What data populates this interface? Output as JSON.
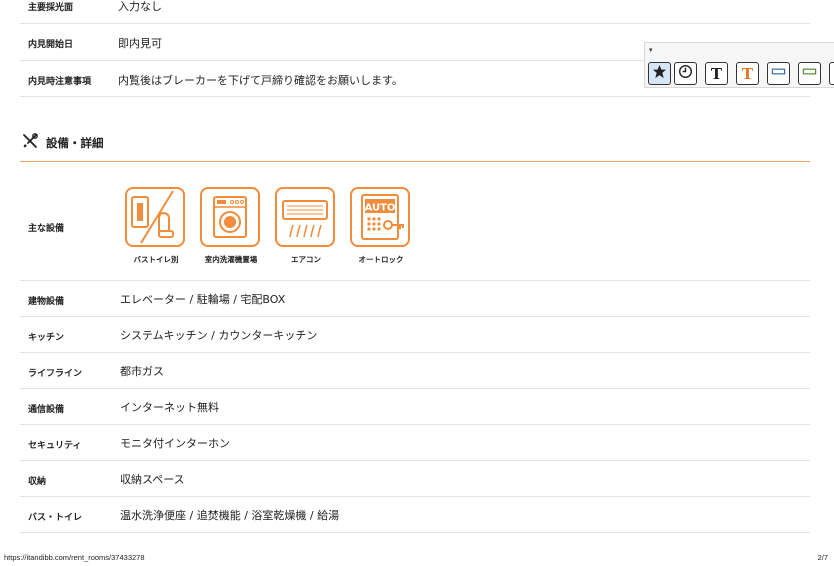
{
  "top_rows": [
    {
      "label": "主要採光面",
      "value": "入力なし"
    },
    {
      "label": "内見開始日",
      "value": "即内見可"
    },
    {
      "label": "内見時注意事項",
      "value": "内覧後はブレーカーを下げて戸締り確認をお願いします。"
    }
  ],
  "section": {
    "title": "設備・詳細",
    "icon": "tools-icon"
  },
  "features": {
    "label": "主な設備",
    "items": [
      {
        "caption": "バストイレ別",
        "icon": "bath-toilet-separate-icon"
      },
      {
        "caption": "室内洗濯機置場",
        "icon": "washing-machine-icon"
      },
      {
        "caption": "エアコン",
        "icon": "air-conditioner-icon"
      },
      {
        "caption": "オートロック",
        "icon": "auto-lock-icon",
        "icon_text": "AUTO"
      }
    ]
  },
  "detail_rows": [
    {
      "label": "建物設備",
      "value": "エレベーター / 駐輪場 / 宅配BOX"
    },
    {
      "label": "キッチン",
      "value": "システムキッチン / カウンターキッチン"
    },
    {
      "label": "ライフライン",
      "value": "都市ガス"
    },
    {
      "label": "通信設備",
      "value": "インターネット無料"
    },
    {
      "label": "セキュリティ",
      "value": "モニタ付インターホン"
    },
    {
      "label": "収納",
      "value": "収納スペース"
    },
    {
      "label": "バス・トイレ",
      "value": "温水洗浄便座 / 追焚機能 / 浴室乾燥機 / 給湯"
    }
  ],
  "toolbar": {
    "buttons": [
      {
        "icon": "star-icon"
      },
      {
        "icon": "clock-icon"
      },
      {
        "icon": "text-icon",
        "glyph": "T"
      },
      {
        "icon": "text-color-icon",
        "glyph": "T"
      },
      {
        "icon": "line-icon"
      },
      {
        "icon": "highlight-line-icon"
      }
    ]
  },
  "footer": {
    "url": "https://itandibb.com/rent_rooms/37433278",
    "page": "2/7"
  },
  "colors": {
    "accent": "#f08c3c",
    "divider": "#e2e2e2",
    "text_orange": "#e8742a"
  }
}
